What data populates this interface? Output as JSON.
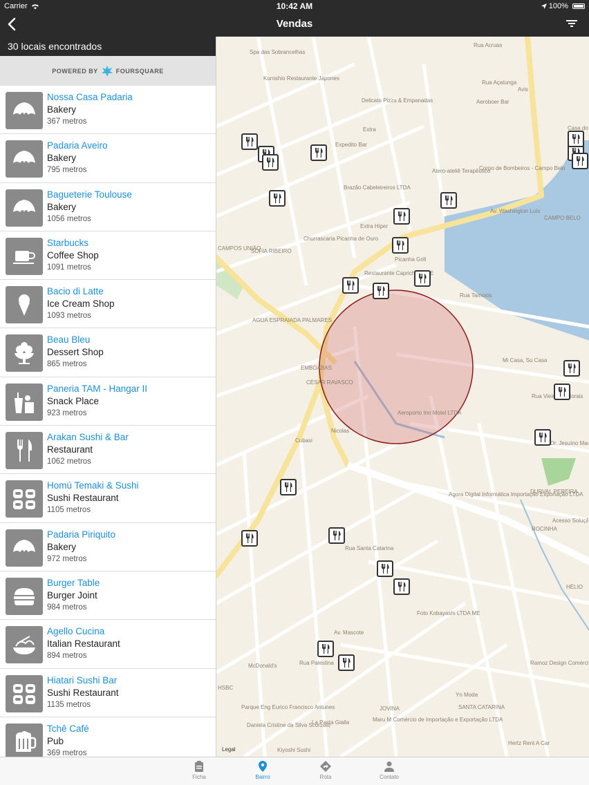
{
  "status": {
    "carrier": "Carrier",
    "time": "10:42 AM",
    "battery": "100%"
  },
  "nav": {
    "title": "Vendas"
  },
  "results": {
    "count_label": "30 locais encontrados"
  },
  "powered": {
    "prefix": "POWERED BY",
    "brand": "FOURSQUARE"
  },
  "places": [
    {
      "name": "Nossa Casa Padaria",
      "category": "Bakery",
      "distance": "367 metros",
      "icon": "croissant-icon"
    },
    {
      "name": "Padaria Aveiro",
      "category": "Bakery",
      "distance": "795 metros",
      "icon": "croissant-icon"
    },
    {
      "name": "Bagueterie Toulouse",
      "category": "Bakery",
      "distance": "1056 metros",
      "icon": "croissant-icon"
    },
    {
      "name": "Starbucks",
      "category": "Coffee Shop",
      "distance": "1091 metros",
      "icon": "coffee-cup-icon"
    },
    {
      "name": "Bacio di Latte",
      "category": "Ice Cream Shop",
      "distance": "1093 metros",
      "icon": "ice-cream-icon"
    },
    {
      "name": "Beau Bleu",
      "category": "Dessert Shop",
      "distance": "865 metros",
      "icon": "dessert-icon"
    },
    {
      "name": "Paneria TAM - Hangar II",
      "category": "Snack Place",
      "distance": "923 metros",
      "icon": "snack-icon"
    },
    {
      "name": "Arakan Sushi & Bar",
      "category": "Restaurant",
      "distance": "1062 metros",
      "icon": "fork-knife-icon"
    },
    {
      "name": "Homú Temaki & Sushi",
      "category": "Sushi Restaurant",
      "distance": "1105 metros",
      "icon": "sushi-icon"
    },
    {
      "name": "Padaria Piriquito",
      "category": "Bakery",
      "distance": "972 metros",
      "icon": "croissant-icon"
    },
    {
      "name": "Burger Table",
      "category": "Burger Joint",
      "distance": "984 metros",
      "icon": "burger-icon"
    },
    {
      "name": "Agello Cucina",
      "category": "Italian Restaurant",
      "distance": "894 metros",
      "icon": "pasta-icon"
    },
    {
      "name": "Hiatari Sushi Bar",
      "category": "Sushi Restaurant",
      "distance": "1135 metros",
      "icon": "sushi-icon"
    },
    {
      "name": "Tchê Café",
      "category": "Pub",
      "distance": "369 metros",
      "icon": "beer-mug-icon"
    }
  ],
  "map": {
    "legal": "Legal",
    "labels": [
      "Spa das Sobrancelhas",
      "Kuroshio Restaurante Japones",
      "Delicato Pizza & Empanadas",
      "Aeroboer Bar",
      "Avis",
      "Casa do Queijo",
      "Extra",
      "Expedito Bar",
      "Atero-ateliê Terapêutico",
      "Corpo de Bombeiros - Campo Belo",
      "Brazão Cabeleireiros LTDA",
      "Churrascaria Picanha de Ouro",
      "Extra Hiper",
      "Picanha Grill",
      "Restaurante Caprichoso ME",
      "CAMPO BELO",
      "CAMPOS UNIÃO",
      "SOFIA RIBEIRO",
      "AGUA ESPRAIADA PALMARES",
      "EMBOABAS",
      "CÉSAR RAVASCO",
      "Aeroporto Inn Motel LTDA",
      "Mi Casa, Su Casa",
      "Cubasi",
      "Nicolas",
      "Agora Digital Informática Importação Exportação LTDA",
      "DURVAL PEREIRA",
      "ROCINHA",
      "HÉLIO",
      "Foto Kobayashi LTDA ME",
      "Ramoz Design Comércio e Serviços Eireli",
      "McDonald's",
      "HSBC",
      "Parque Eng Eurico Francisco Antunes",
      "Yn Moda",
      "SANTA CATARINA",
      "JOVINA",
      "La Pasta Gialla",
      "Maru M Comércio de Importação e Exportação LTDA",
      "Daniela Cristine da Silva Scorzato",
      "Kiyoshi Sushi",
      "Hertz Rent A Car",
      "Acesso Solução em Automa",
      "Rua Acruas",
      "Rua Açatunga",
      "Av. Washington Luís",
      "Rua Tamoios",
      "Rua Vieira de Morais",
      "Rua Santa Catarina",
      "Av. Mascote",
      "Rua Palestina",
      "Rua Dr. Jesuíno Maciel"
    ]
  },
  "tabs": [
    {
      "label": "Ficha",
      "icon": "clipboard-icon"
    },
    {
      "label": "Bairro",
      "icon": "map-pin-icon"
    },
    {
      "label": "Rota",
      "icon": "route-icon"
    },
    {
      "label": "Contato",
      "icon": "person-icon"
    }
  ],
  "colors": {
    "accent": "#1c8fd6",
    "bar": "#2b2b2b",
    "radius": "#8b1a1a"
  }
}
